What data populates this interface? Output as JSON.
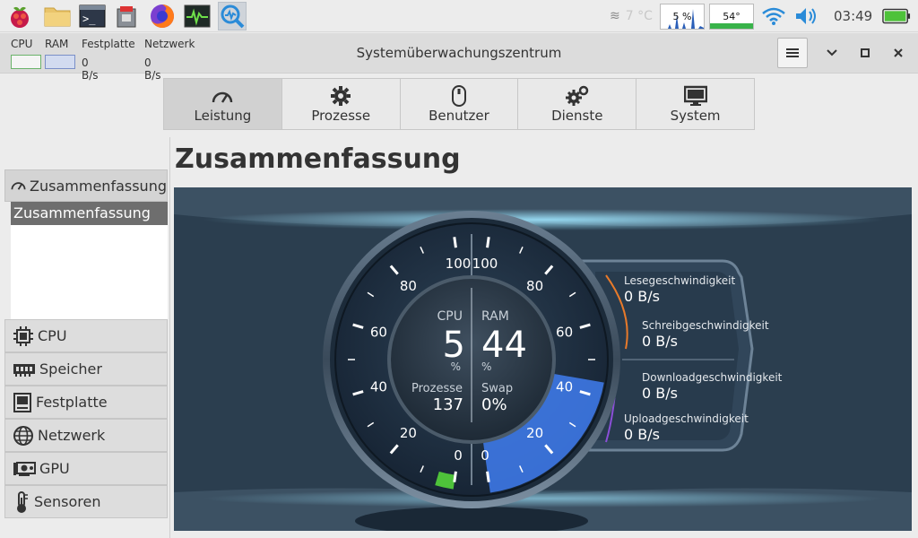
{
  "taskbar": {
    "temp": "7 °C",
    "cpu_graph": "5 %",
    "temp_graph": "54°",
    "clock": "03:49"
  },
  "window": {
    "title": "Systemüberwachungszentrum",
    "mini": {
      "cpu_label": "CPU",
      "ram_label": "RAM",
      "disk_label": "Festplatte",
      "net_label": "Netzwerk",
      "disk_value": "0 B/s",
      "net_value": "0 B/s"
    }
  },
  "tabs": [
    {
      "label": "Leistung",
      "icon": "gauge-icon"
    },
    {
      "label": "Prozesse",
      "icon": "gear-icon"
    },
    {
      "label": "Benutzer",
      "icon": "mouse-icon"
    },
    {
      "label": "Dienste",
      "icon": "gears-icon"
    },
    {
      "label": "System",
      "icon": "monitor-icon"
    }
  ],
  "sidebar": {
    "header": "Zusammenfassung",
    "selected": "Zusammenfassung",
    "items": [
      {
        "label": "CPU",
        "icon": "cpu-icon"
      },
      {
        "label": "Speicher",
        "icon": "memory-icon"
      },
      {
        "label": "Festplatte",
        "icon": "disk-icon"
      },
      {
        "label": "Netzwerk",
        "icon": "globe-icon"
      },
      {
        "label": "GPU",
        "icon": "gpu-icon"
      },
      {
        "label": "Sensoren",
        "icon": "thermometer-icon"
      }
    ]
  },
  "page": {
    "title": "Zusammenfassung"
  },
  "dashboard": {
    "cpu_label": "CPU",
    "cpu_value": "5",
    "cpu_unit": "%",
    "cpu_fraction": 0.05,
    "ram_label": "RAM",
    "ram_value": "44",
    "ram_unit": "%",
    "ram_fraction": 0.44,
    "processes_label": "Prozesse",
    "processes_value": "137",
    "swap_label": "Swap",
    "swap_value": "0%",
    "left_ticks": [
      "0",
      "20",
      "40",
      "60",
      "80",
      "100"
    ],
    "right_ticks": [
      "0",
      "20",
      "40",
      "60",
      "80",
      "100"
    ],
    "read_label": "Lesegeschwindigkeit",
    "read_value": "0 B/s",
    "write_label": "Schreibgeschwindigkeit",
    "write_value": "0 B/s",
    "download_label": "Downloadgeschwindigkeit",
    "download_value": "0 B/s",
    "upload_label": "Uploadgeschwindigkeit",
    "upload_value": "0 B/s",
    "colors": {
      "cpu": "#4ec23a",
      "ram": "#3f7cf0",
      "disk": "#e87a2a",
      "net": "#8b4fd8"
    }
  }
}
